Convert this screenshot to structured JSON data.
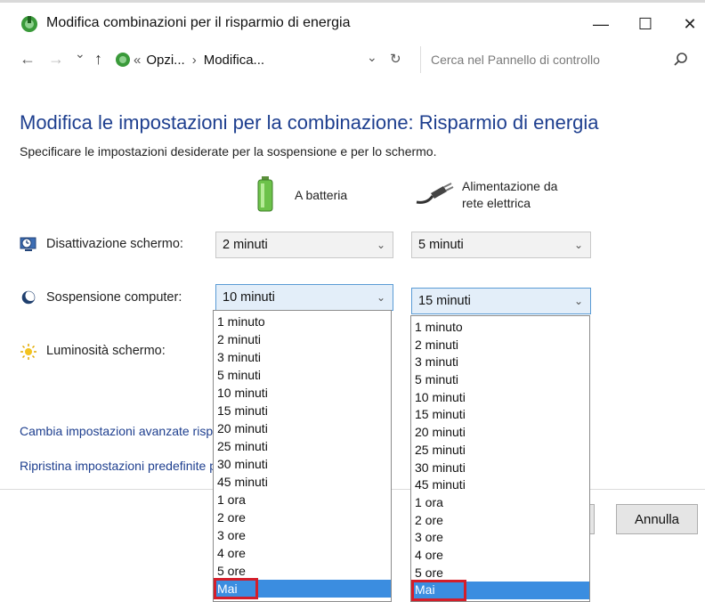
{
  "window": {
    "title": "Modifica combinazioni per il risparmio di energia",
    "minimize": "—",
    "maximize": "☐",
    "close": "✕"
  },
  "nav": {
    "back": "←",
    "forward": "→",
    "recent": "⌄",
    "up": "↑",
    "breadcrumb_prefix": "«",
    "breadcrumb_1": "Opzi...",
    "breadcrumb_sep": "›",
    "breadcrumb_2": "Modifica...",
    "dropdown": "⌄",
    "refresh": "↻",
    "search_placeholder": "Cerca nel Pannello di controllo"
  },
  "main": {
    "title": "Modifica le impostazioni per la combinazione: Risparmio di energia",
    "subtitle": "Specificare le impostazioni desiderate per la sospensione e per lo schermo.",
    "col_battery": "A batteria",
    "col_ac_line1": "Alimentazione da",
    "col_ac_line2": "rete elettrica"
  },
  "rows": {
    "display_off": {
      "label": "Disattivazione schermo:",
      "battery_value": "2 minuti",
      "ac_value": "5 minuti"
    },
    "sleep": {
      "label": "Sospensione computer:",
      "battery_value": "10 minuti",
      "ac_value": "15 minuti"
    },
    "brightness": {
      "label": "Luminosità schermo:"
    }
  },
  "dropdown_options": [
    "1 minuto",
    "2 minuti",
    "3 minuti",
    "5 minuti",
    "10 minuti",
    "15 minuti",
    "20 minuti",
    "25 minuti",
    "30 minuti",
    "45 minuti",
    "1 ora",
    "2 ore",
    "3 ore",
    "4 ore",
    "5 ore",
    "Mai"
  ],
  "highlighted_option": "Mai",
  "links": {
    "advanced": "Cambia impostazioni avanzate risparmio energia",
    "restore": "Ripristina impostazioni predefinite per questa combinazione"
  },
  "buttons": {
    "cancel": "Annulla"
  },
  "colors": {
    "heading": "#1e3f8f",
    "selection": "#3b8de0",
    "highlight_box": "#d41e2a"
  }
}
